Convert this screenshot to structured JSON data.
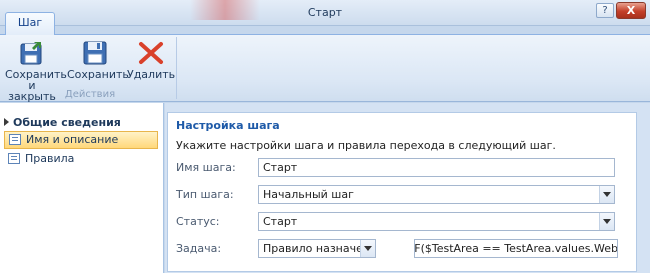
{
  "window": {
    "title": "Старт",
    "help_label": "?",
    "close_label": "X"
  },
  "ribbon": {
    "tab_label": "Шаг",
    "group_label": "Действия",
    "buttons": {
      "save_close_line1": "Сохранить",
      "save_close_line2": "и закрыть",
      "save": "Сохранить",
      "delete": "Удалить"
    }
  },
  "sidebar": {
    "section": "Общие сведения",
    "items": [
      {
        "label": "Имя и описание"
      },
      {
        "label": "Правила"
      }
    ]
  },
  "form": {
    "title": "Настройка шага",
    "description": "Укажите настройки шага и правила перехода в следующий шаг.",
    "step_name_label": "Имя шага:",
    "step_name_value": "Старт",
    "step_type_label": "Тип шага:",
    "step_type_value": "Начальный шаг",
    "status_label": "Статус:",
    "status_value": "Старт",
    "task_label": "Задача:",
    "task_rule_value": "Правило назначения",
    "task_expression_value": "IF($TestArea == TestArea.values.Website,"
  },
  "colors": {
    "accent": "#1e5aa8",
    "selection": "#ffd77a",
    "close": "#c4402a"
  }
}
